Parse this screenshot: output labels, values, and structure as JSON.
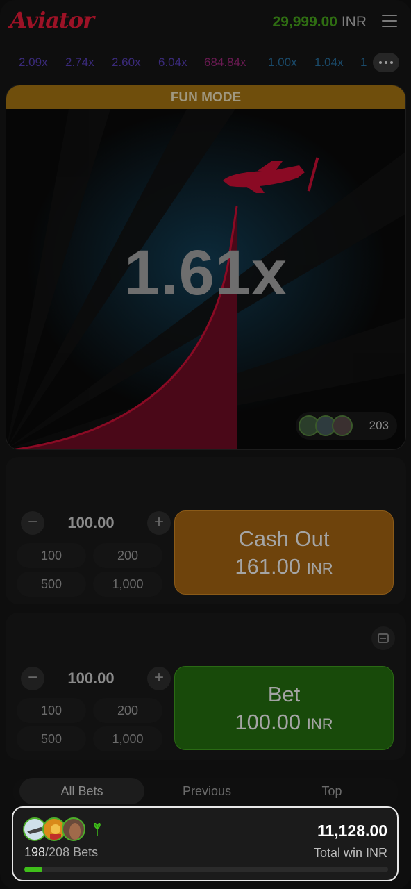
{
  "header": {
    "logo": "Aviator",
    "balance_amount": "29,999.00",
    "balance_currency": "INR",
    "menu_icon": "hamburger-menu-icon"
  },
  "history": [
    {
      "value": "2.09x",
      "color": "#3a2a7a"
    },
    {
      "value": "2.74x",
      "color": "#3a2a7a"
    },
    {
      "value": "2.60x",
      "color": "#3a2a7a"
    },
    {
      "value": "6.04x",
      "color": "#3a2a7a"
    },
    {
      "value": "684.84x",
      "color": "#6a1a52"
    },
    {
      "value": "1.00x",
      "color": "#1a4a6a"
    },
    {
      "value": "1.04x",
      "color": "#1a4a6a"
    },
    {
      "value": "1",
      "color": "#1a4a6a"
    }
  ],
  "game": {
    "mode_banner": "FUN MODE",
    "multiplier": "1.61x",
    "online_players": "203"
  },
  "bet_panel_1": {
    "amount": "100.00",
    "minus": "−",
    "plus": "+",
    "quick": [
      "100",
      "200",
      "500",
      "1,000"
    ],
    "action_label": "Cash Out",
    "action_amount": "161.00",
    "action_currency": "INR"
  },
  "bet_panel_2": {
    "amount": "100.00",
    "minus": "−",
    "plus": "+",
    "quick": [
      "100",
      "200",
      "500",
      "1,000"
    ],
    "action_label": "Bet",
    "action_amount": "100.00",
    "action_currency": "INR"
  },
  "tabs": [
    "All Bets",
    "Previous",
    "Top"
  ],
  "summary": {
    "bets_current": "198",
    "bets_total": "/208 Bets",
    "total_amount": "11,128.00",
    "total_label": "Total win INR",
    "progress_fraction": 0.05
  },
  "colors": {
    "accent_red": "#e50539",
    "cashout_orange": "#d07206",
    "bet_green": "#28a909"
  }
}
